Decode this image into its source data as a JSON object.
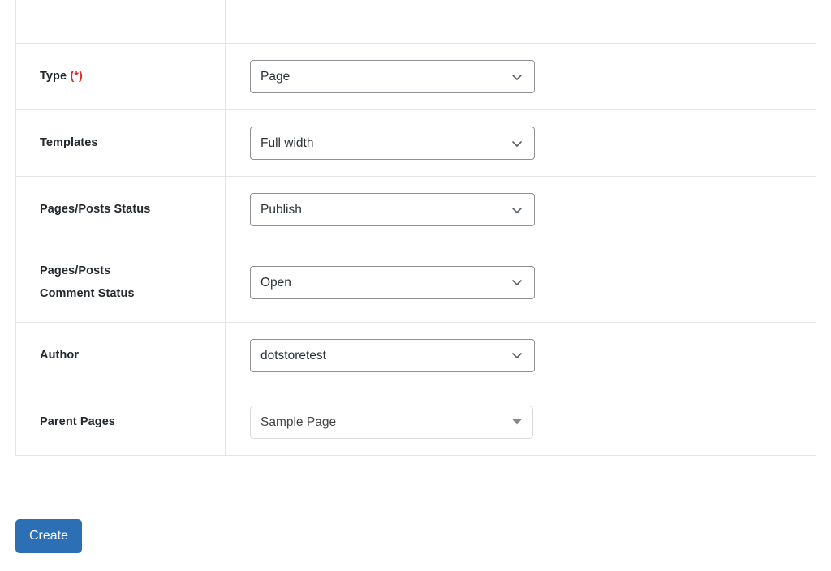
{
  "form": {
    "rows": [
      {
        "label": "",
        "required_marker": "",
        "control": "none",
        "value": "",
        "partial_top_row": true
      },
      {
        "label": "Type",
        "required_marker": "(*)",
        "control": "select",
        "value": "Page",
        "icon": "chevron-down-icon"
      },
      {
        "label": "Templates",
        "required_marker": "",
        "control": "select",
        "value": "Full width",
        "icon": "chevron-down-icon"
      },
      {
        "label": "Pages/Posts Status",
        "required_marker": "",
        "control": "select",
        "value": "Publish",
        "icon": "chevron-down-icon"
      },
      {
        "label": "Pages/Posts Comment Status",
        "required_marker": "",
        "control": "select",
        "value": "Open",
        "icon": "chevron-down-icon"
      },
      {
        "label": "Author",
        "required_marker": "",
        "control": "select",
        "value": "dotstoretest",
        "icon": "chevron-down-icon"
      },
      {
        "label": "Parent Pages",
        "required_marker": "",
        "control": "select2",
        "value": "Sample Page",
        "icon": "caret-down-icon"
      }
    ]
  },
  "actions": {
    "create_label": "Create"
  },
  "colors": {
    "accent": "#2c6fb5",
    "required": "#e02b27",
    "border": "#e5e5e5",
    "select_border": "#8c8f94",
    "select2_border": "#d9d9d9",
    "label_text": "#23282d",
    "value_text": "#2c3338"
  }
}
